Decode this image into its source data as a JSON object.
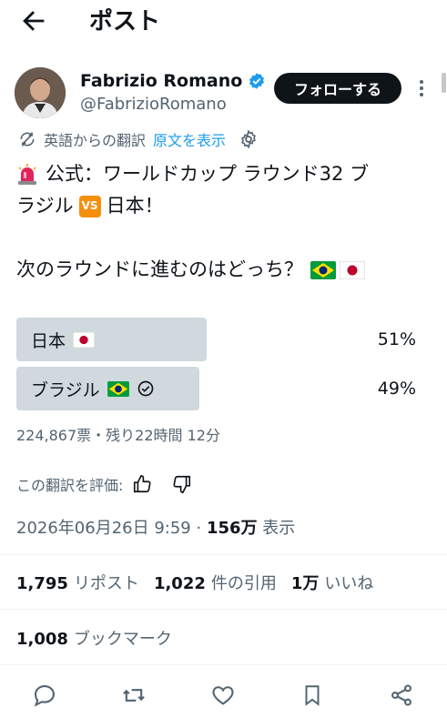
{
  "header": {
    "title": "ポスト"
  },
  "author": {
    "name": "Fabrizio Romano",
    "handle": "@FabrizioRomano",
    "follow_label": "フォローする"
  },
  "translation": {
    "note": "英語からの翻訳",
    "show_original": "原文を表示"
  },
  "tweet": {
    "line1_text": "公式：ワールドカップ ラウンド32 ブ",
    "line2_text_a": "ラジル",
    "line2_text_b": "日本！",
    "line3_text": "次のラウンドに進むのはどっち？",
    "vs_badge": "VS"
  },
  "poll": {
    "options": [
      {
        "label": "日本",
        "percent_text": "51%",
        "percent": 51
      },
      {
        "label": "ブラジル",
        "percent_text": "49%",
        "percent": 49
      }
    ],
    "meta": "224,867票・残り22時間 12分"
  },
  "rate_translation": "この翻訳を評価:",
  "timestamp": {
    "date": "2026年06月26日 9:59",
    "separator": "·",
    "views": "156万",
    "views_label": "表示"
  },
  "stats": {
    "reposts": {
      "count": "1,795",
      "label": "リポスト"
    },
    "quotes": {
      "count": "1,022",
      "label": "件の引用"
    },
    "likes": {
      "count": "1万",
      "label": "いいね"
    },
    "bookmarks": {
      "count": "1,008",
      "label": "ブックマーク"
    }
  },
  "colors": {
    "verified": "#1d9bf0",
    "link": "#1d9bf0",
    "poll_bar": "#cfd9de",
    "text": "#0f1419",
    "muted": "#536471"
  }
}
